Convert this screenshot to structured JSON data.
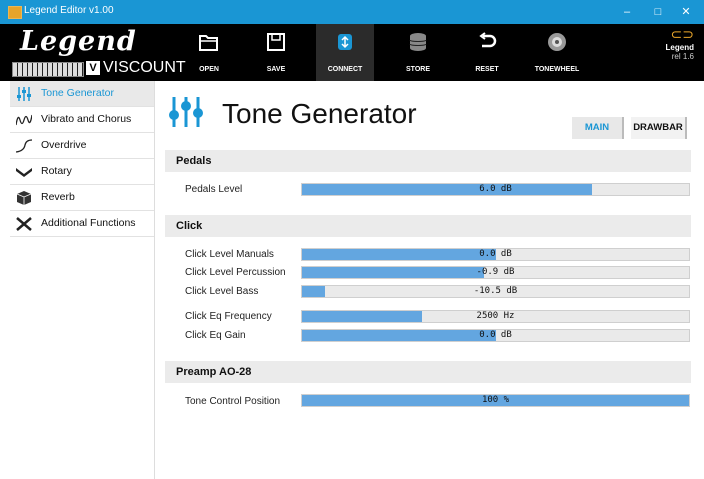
{
  "window": {
    "title": "Legend Editor v1.00",
    "min": "–",
    "max": "□",
    "close": "✕"
  },
  "logo": {
    "brand": "Legend",
    "maker": "VISCOUNT",
    "badge": "V"
  },
  "toolbar": {
    "open": "OPEN",
    "save": "SAVE",
    "connect": "CONNECT",
    "store": "STORE",
    "reset": "RESET",
    "tonewheel": "TONEWHEEL"
  },
  "release": {
    "name": "Legend",
    "version": "rel 1.6"
  },
  "sidebar": {
    "items": [
      {
        "label": "Tone Generator",
        "active": true
      },
      {
        "label": "Vibrato and Chorus"
      },
      {
        "label": "Overdrive"
      },
      {
        "label": "Rotary"
      },
      {
        "label": "Reverb"
      },
      {
        "label": "Additional Functions"
      }
    ]
  },
  "page": {
    "title": "Tone Generator",
    "tabs": {
      "main": "MAIN",
      "drawbar": "DRAWBAR"
    }
  },
  "sections": {
    "pedals": {
      "title": "Pedals",
      "rows": [
        {
          "label": "Pedals Level",
          "value": "6.0 dB",
          "fill": 0.75
        }
      ]
    },
    "click": {
      "title": "Click",
      "rows": [
        {
          "label": "Click Level Manuals",
          "value": "0.0 dB",
          "fill": 0.5
        },
        {
          "label": "Click Level Percussion",
          "value": "-0.9 dB",
          "fill": 0.47
        },
        {
          "label": "Click Level Bass",
          "value": "-10.5 dB",
          "fill": 0.06
        },
        {
          "label": "Click Eq Frequency",
          "value": "2500 Hz",
          "fill": 0.31
        },
        {
          "label": "Click Eq Gain",
          "value": "0.0 dB",
          "fill": 0.5
        }
      ]
    },
    "preamp": {
      "title": "Preamp AO-28",
      "rows": [
        {
          "label": "Tone Control Position",
          "value": "100 %",
          "fill": 1.0
        }
      ]
    }
  },
  "colors": {
    "accent": "#1a96d4",
    "bar_fill": "#63a6e0",
    "brand_orange": "#e7a42a"
  }
}
